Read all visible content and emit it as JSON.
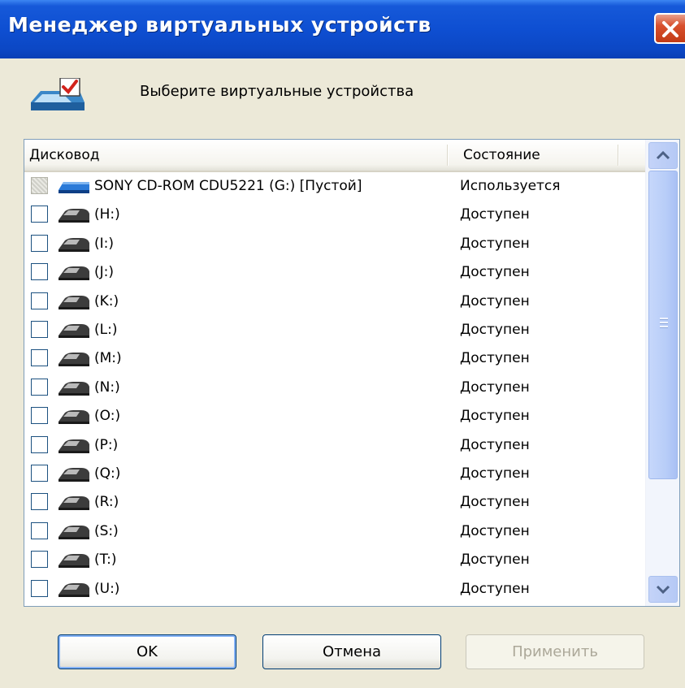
{
  "window": {
    "title": "Менеджер виртуальных устройств",
    "close_icon": "close-icon"
  },
  "header": {
    "icon": "virtual-drive-check-icon",
    "text": "Выберите виртуальные устройства"
  },
  "table": {
    "columns": [
      "Дисковод",
      "Состояние"
    ],
    "rows": [
      {
        "name": "SONY CD-ROM CDU5221 (G:) [Пустой]",
        "status": "Используется",
        "checked": false,
        "enabled": false,
        "icon": "physical-drive-icon"
      },
      {
        "name": "(H:)",
        "status": "Доступен",
        "checked": false,
        "enabled": true,
        "icon": "virtual-drive-icon"
      },
      {
        "name": "(I:)",
        "status": "Доступен",
        "checked": false,
        "enabled": true,
        "icon": "virtual-drive-icon"
      },
      {
        "name": "(J:)",
        "status": "Доступен",
        "checked": false,
        "enabled": true,
        "icon": "virtual-drive-icon"
      },
      {
        "name": "(K:)",
        "status": "Доступен",
        "checked": false,
        "enabled": true,
        "icon": "virtual-drive-icon"
      },
      {
        "name": "(L:)",
        "status": "Доступен",
        "checked": false,
        "enabled": true,
        "icon": "virtual-drive-icon"
      },
      {
        "name": "(M:)",
        "status": "Доступен",
        "checked": false,
        "enabled": true,
        "icon": "virtual-drive-icon"
      },
      {
        "name": "(N:)",
        "status": "Доступен",
        "checked": false,
        "enabled": true,
        "icon": "virtual-drive-icon"
      },
      {
        "name": "(O:)",
        "status": "Доступен",
        "checked": false,
        "enabled": true,
        "icon": "virtual-drive-icon"
      },
      {
        "name": "(P:)",
        "status": "Доступен",
        "checked": false,
        "enabled": true,
        "icon": "virtual-drive-icon"
      },
      {
        "name": "(Q:)",
        "status": "Доступен",
        "checked": false,
        "enabled": true,
        "icon": "virtual-drive-icon"
      },
      {
        "name": "(R:)",
        "status": "Доступен",
        "checked": false,
        "enabled": true,
        "icon": "virtual-drive-icon"
      },
      {
        "name": "(S:)",
        "status": "Доступен",
        "checked": false,
        "enabled": true,
        "icon": "virtual-drive-icon"
      },
      {
        "name": "(T:)",
        "status": "Доступен",
        "checked": false,
        "enabled": true,
        "icon": "virtual-drive-icon"
      },
      {
        "name": "(U:)",
        "status": "Доступен",
        "checked": false,
        "enabled": true,
        "icon": "virtual-drive-icon"
      }
    ]
  },
  "buttons": {
    "ok": "OK",
    "cancel": "Отмена",
    "apply": "Применить",
    "apply_enabled": false
  },
  "colors": {
    "titlebar": "#0c47c4",
    "dialog_bg": "#ece9d8",
    "close": "#d8502d",
    "scrollbar": "#b8cdf8"
  }
}
